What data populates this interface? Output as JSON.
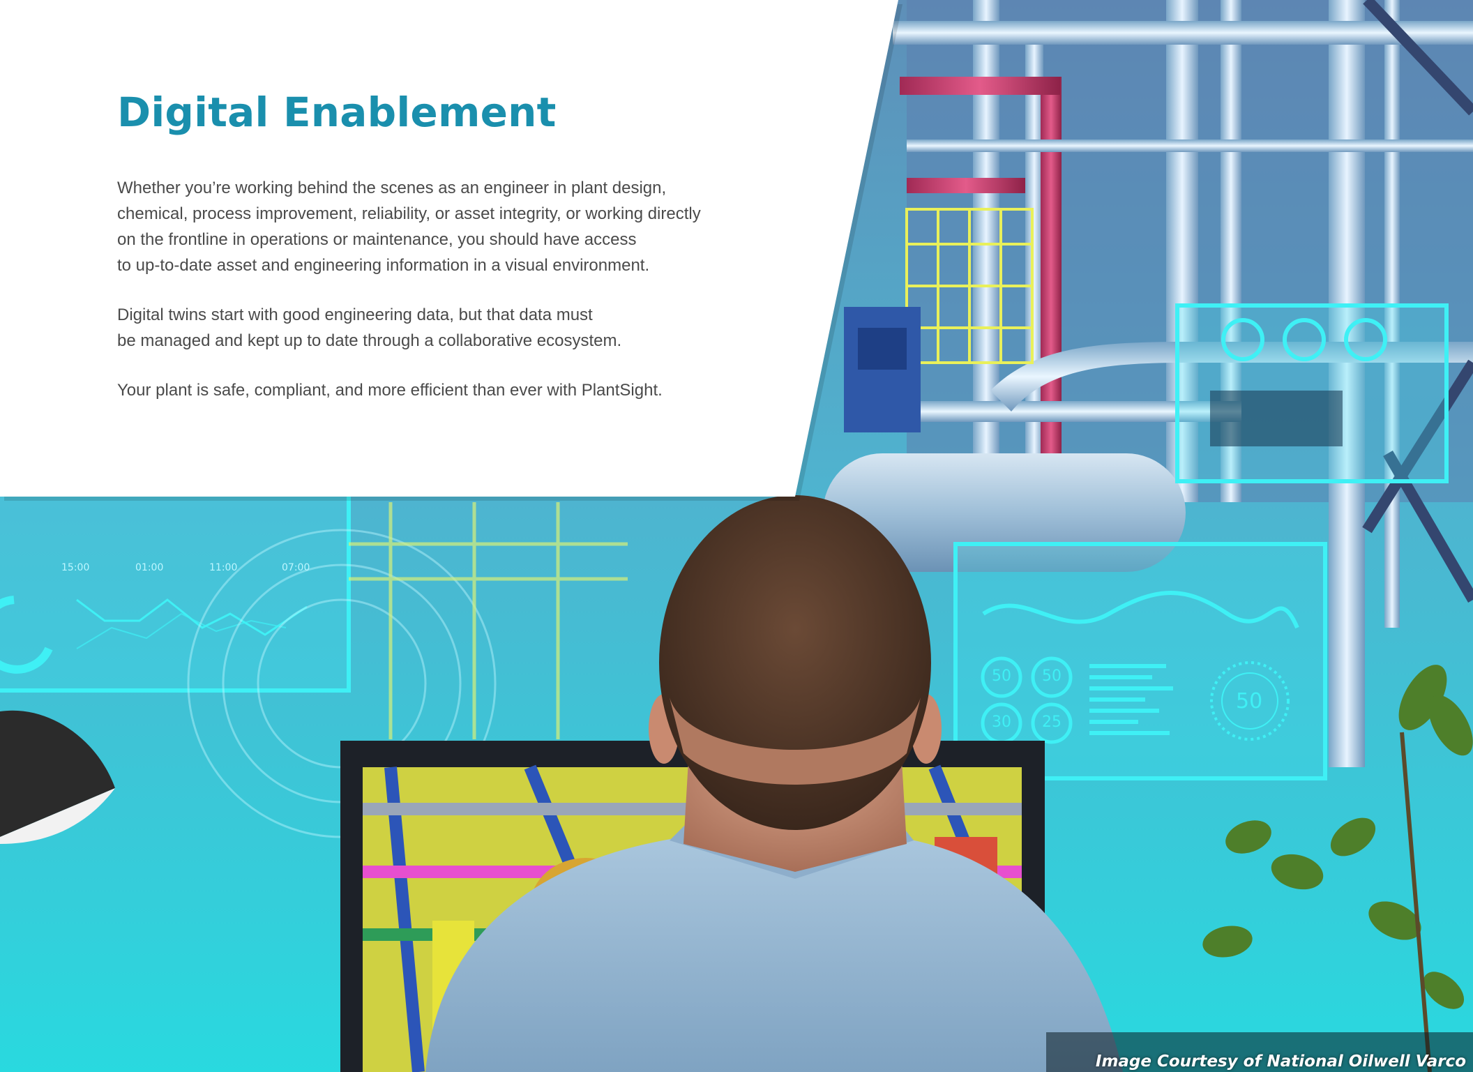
{
  "headline": "Digital Enablement",
  "paragraphs": [
    {
      "lines": [
        "Whether you’re working behind the scenes as an engineer in plant design,",
        "chemical, process improvement, reliability, or asset integrity, or working directly",
        "on the frontline in operations or maintenance, you should have access",
        "to up-to-date asset and engineering information in a visual environment."
      ]
    },
    {
      "lines": [
        "Digital twins start with good engineering data, but that data must",
        "be managed and kept up to date through a collaborative ecosystem."
      ]
    },
    {
      "lines": [
        "Your plant is safe, compliant, and more efficient than ever with PlantSight."
      ]
    }
  ],
  "overlay_gauges_top": [
    "",
    "",
    ""
  ],
  "overlay_gauges_dashboard": [
    "50",
    "50",
    "30",
    "25"
  ],
  "overlay_big_gauge": "50",
  "overlay_axis_ticks": [
    "15:00",
    "01:00",
    "11:00",
    "07:00"
  ],
  "image_credit": "Image Courtesy of National Oilwell Varco",
  "colors": {
    "headline": "#1a8fad",
    "body_text": "#4a4a4a",
    "hud_cyan": "#3ff0f5",
    "panel_white": "#ffffff"
  }
}
